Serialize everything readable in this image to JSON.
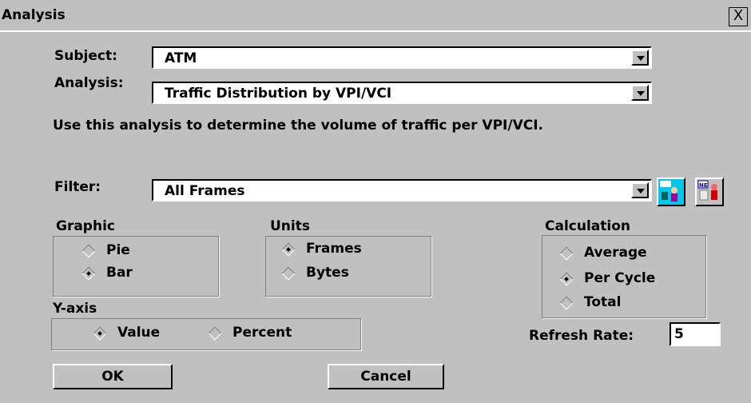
{
  "window": {
    "title": "Analysis",
    "close_glyph": "X"
  },
  "subject": {
    "label": "Subject:",
    "value": "ATM"
  },
  "analysis": {
    "label": "Analysis:",
    "value": "Traffic Distribution by VPI/VCI",
    "description": "Use this analysis to determine the volume of traffic per VPI/VCI."
  },
  "filter": {
    "label": "Filter:",
    "value": "All Frames",
    "icon1": "filter-edit-icon",
    "icon2": "filter-new-icon"
  },
  "graphic": {
    "label": "Graphic",
    "options": [
      {
        "label": "Pie",
        "selected": false
      },
      {
        "label": "Bar",
        "selected": true
      }
    ]
  },
  "units": {
    "label": "Units",
    "options": [
      {
        "label": "Frames",
        "selected": true
      },
      {
        "label": "Bytes",
        "selected": false
      }
    ]
  },
  "calculation": {
    "label": "Calculation",
    "options": [
      {
        "label": "Average",
        "selected": false
      },
      {
        "label": "Per Cycle",
        "selected": true
      },
      {
        "label": "Total",
        "selected": false
      }
    ]
  },
  "yaxis": {
    "label": "Y-axis",
    "options": [
      {
        "label": "Value",
        "selected": true
      },
      {
        "label": "Percent",
        "selected": false
      }
    ]
  },
  "refresh": {
    "label": "Refresh Rate:",
    "value": "5"
  },
  "buttons": {
    "ok": "OK",
    "cancel": "Cancel"
  }
}
